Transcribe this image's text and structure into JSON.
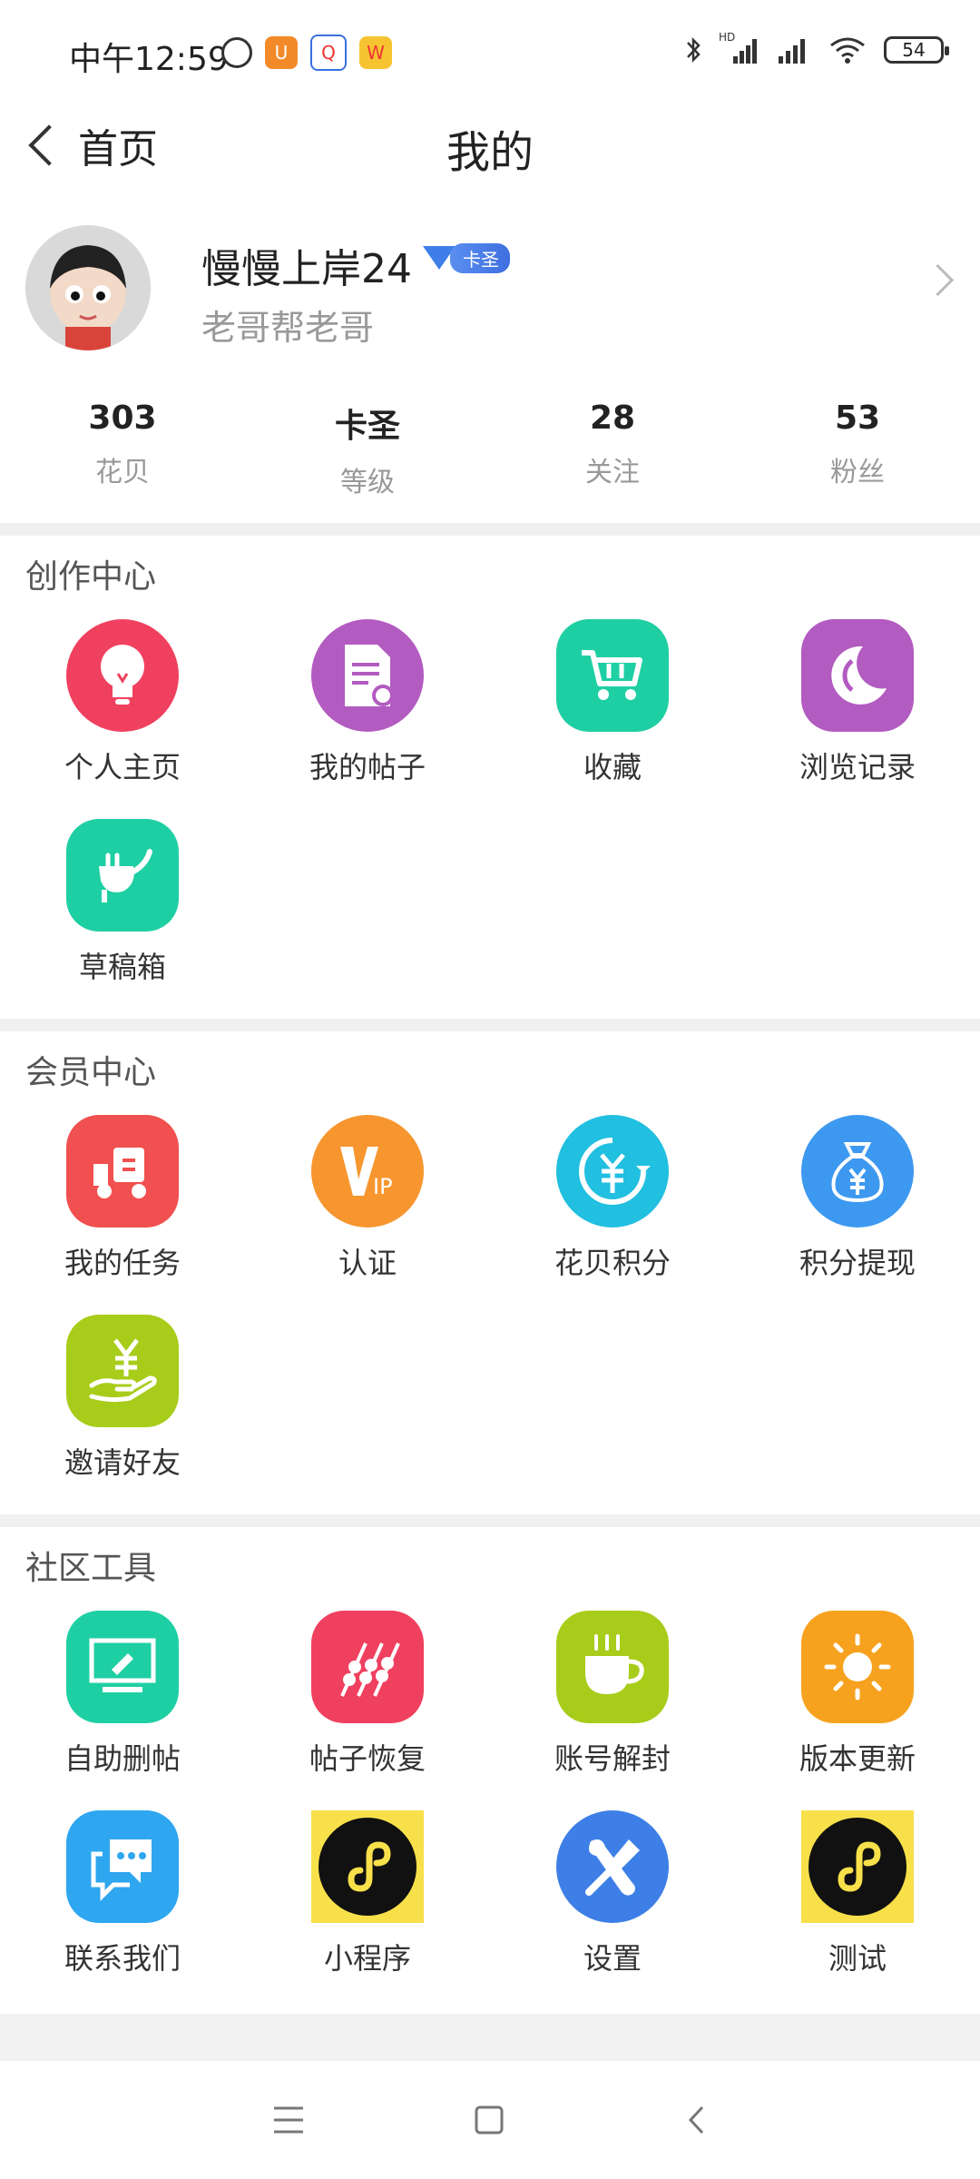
{
  "status_bar": {
    "time": "中午12:59",
    "battery": "54",
    "network_badge": "HD"
  },
  "nav": {
    "back_label": "首页",
    "title": "我的"
  },
  "profile": {
    "username": "慢慢上岸24",
    "badge": "卡圣",
    "signature": "老哥帮老哥"
  },
  "stats": [
    {
      "value": "303",
      "label": "花贝"
    },
    {
      "value": "卡圣",
      "label": "等级"
    },
    {
      "value": "28",
      "label": "关注"
    },
    {
      "value": "53",
      "label": "粉丝"
    }
  ],
  "sections": {
    "creation": {
      "title": "创作中心",
      "items": [
        {
          "label": "个人主页",
          "icon": "bulb-icon",
          "color": "#f0405f"
        },
        {
          "label": "我的帖子",
          "icon": "document-icon",
          "color": "#b25bc0"
        },
        {
          "label": "收藏",
          "icon": "cart-icon",
          "color": "#1fcfa4"
        },
        {
          "label": "浏览记录",
          "icon": "moon-icon",
          "color": "#b25bc0"
        },
        {
          "label": "草稿箱",
          "icon": "draft-icon",
          "color": "#1fcfa4"
        }
      ]
    },
    "member": {
      "title": "会员中心",
      "items": [
        {
          "label": "我的任务",
          "icon": "scooter-icon",
          "color": "#f0504f"
        },
        {
          "label": "认证",
          "icon": "vip-icon",
          "color": "#f7962f"
        },
        {
          "label": "花贝积分",
          "icon": "yuan-exchange-icon",
          "color": "#21bfe0"
        },
        {
          "label": "积分提现",
          "icon": "money-bag-icon",
          "color": "#3d98f0"
        },
        {
          "label": "邀请好友",
          "icon": "yuan-hand-icon",
          "color": "#a8cc1a"
        }
      ]
    },
    "tools": {
      "title": "社区工具",
      "items": [
        {
          "label": "自助删帖",
          "icon": "monitor-icon",
          "color": "#1fcfa4"
        },
        {
          "label": "帖子恢复",
          "icon": "skewer-icon",
          "color": "#f0405f"
        },
        {
          "label": "账号解封",
          "icon": "cup-icon",
          "color": "#a8cc1a"
        },
        {
          "label": "版本更新",
          "icon": "sun-icon",
          "color": "#f7a21e"
        },
        {
          "label": "联系我们",
          "icon": "chat-icon",
          "color": "#2ea6f0"
        },
        {
          "label": "小程序",
          "icon": "mini-program-icon",
          "color": "#f8e04a"
        },
        {
          "label": "设置",
          "icon": "wrench-icon",
          "color": "#3d7fe6"
        },
        {
          "label": "测试",
          "icon": "mini-program-icon",
          "color": "#f8e04a"
        }
      ]
    }
  }
}
